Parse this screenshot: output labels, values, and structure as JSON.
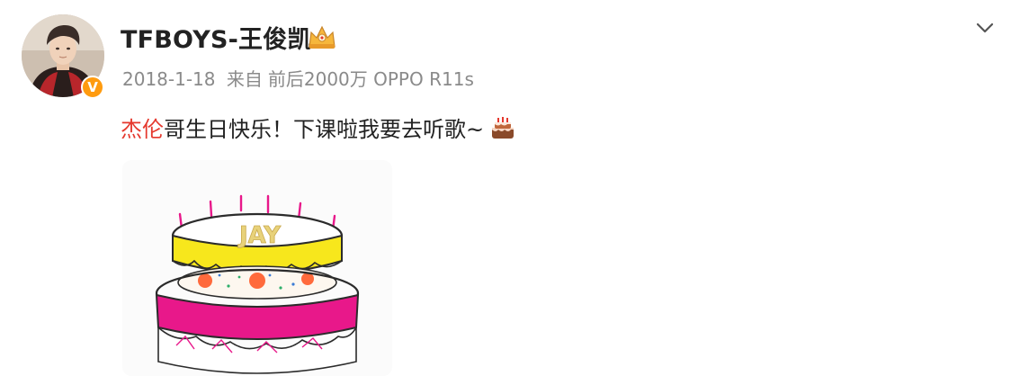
{
  "post": {
    "username": "TFBOYS-王俊凯",
    "verified_mark": "V",
    "timestamp": "2018-1-18",
    "source_prefix": "来自",
    "source_tail": "前后2000万 OPPO R11s",
    "content": {
      "mention": "杰伦",
      "text": "哥生日快乐！下课啦我要去听歌~"
    },
    "image": {
      "cake_text": "JAY"
    }
  },
  "icons": {
    "member_badge": "member-crown-icon",
    "chevron": "chevron-down-icon",
    "cake_emoji": "birthday-cake-icon"
  },
  "colors": {
    "mention": "#e5382d",
    "verified": "#ff9b0f",
    "meta": "#8a8a8a",
    "cake_yellow": "#f7e71c",
    "cake_pink": "#e8188a"
  }
}
